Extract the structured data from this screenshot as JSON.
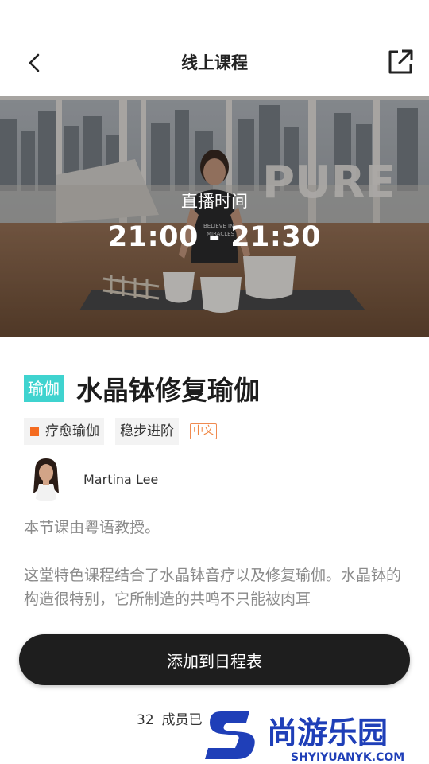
{
  "header": {
    "title": "线上课程",
    "back_icon": "chevron-left-icon",
    "share_icon": "share-external-icon"
  },
  "hero": {
    "live_label": "直播时间",
    "live_time": "21:00 - 21:30",
    "studio_sign": "PURE",
    "shirt_text": "BELIEVE IN MIRACLES"
  },
  "course": {
    "category": "瑜伽",
    "title": "水晶钵修复瑜伽",
    "tags": [
      {
        "label": "疗愈瑜伽",
        "color": "#f46b20"
      },
      {
        "label": "稳步进阶"
      }
    ],
    "language": "中文",
    "instructor": "Martina Lee",
    "description": [
      "本节课由粤语教授。",
      "这堂特色课程结合了水晶钵音疗以及修复瑜伽。水晶钵的构造很特别，它所制造的共鸣不只能被肉耳"
    ]
  },
  "cta": {
    "label": "添加到日程表"
  },
  "members": {
    "count": "32",
    "text": "成员已"
  },
  "watermark": {
    "name": "尚游乐园",
    "url": "SHYIYUANYK.COM"
  },
  "colors": {
    "accent": "#3fd3cf",
    "tag_square": "#f46b20",
    "lang": "#f0843f",
    "cta": "#1e1e1e"
  }
}
